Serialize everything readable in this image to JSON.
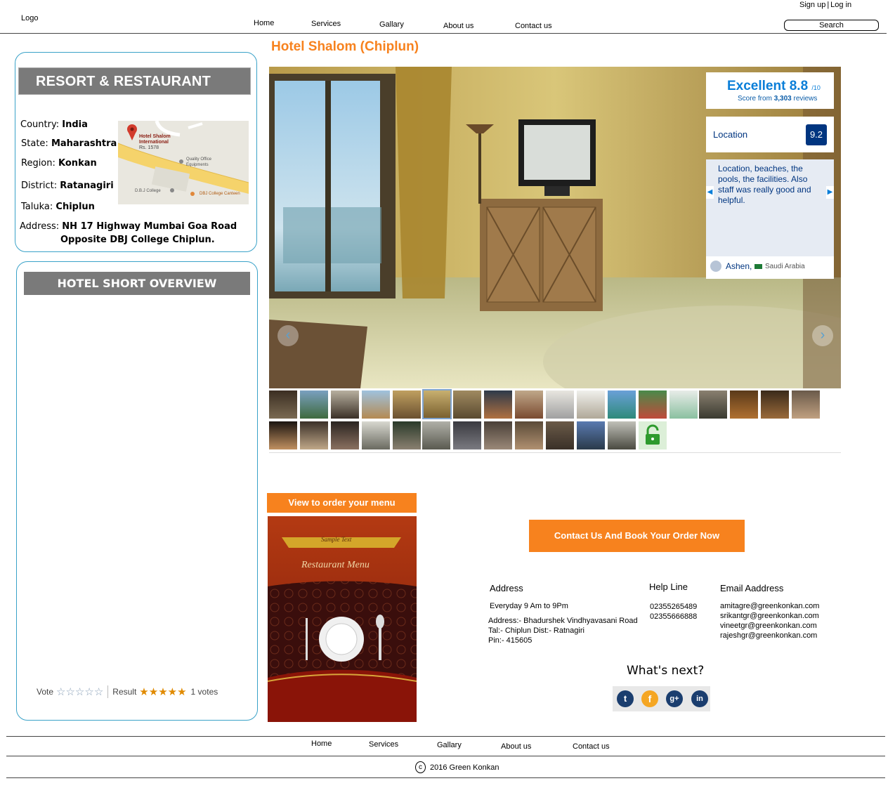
{
  "header": {
    "logo": "Logo",
    "signup": "Sign up",
    "sep": "|",
    "login": "Log in",
    "nav": [
      "Home",
      "Services",
      "Gallary",
      "About us",
      "Contact us"
    ],
    "search": "Search"
  },
  "resort": {
    "title": "RESORT & RESTAURANT",
    "country_label": "Country:",
    "country": "India",
    "state_label": "State:",
    "state": "Maharashtra",
    "region_label": "Region:",
    "region": "Konkan",
    "district_label": "District:",
    "district": "Ratanagiri",
    "taluka_label": "Taluka:",
    "taluka": "Chiplun",
    "address_label": "Address:",
    "address_line1": "NH 17 Highway Mumbai Goa Road",
    "address_line2": "Opposite DBJ College Chiplun."
  },
  "map": {
    "hotel_name_1": "Hotel Shalom",
    "hotel_name_2": "International",
    "hotel_price": "Rs. 1578",
    "quality_1": "Quality Office",
    "quality_2": "Equipments",
    "college": "D.B.J College",
    "canteen": "DBJ College Canteen"
  },
  "overview": {
    "title": "HOTEL SHORT OVERVIEW",
    "vote_label": "Vote",
    "vote_stars": "☆☆☆☆☆",
    "result_label": "Result",
    "result_stars": "★★★★★",
    "votes": "1 votes"
  },
  "hotel": {
    "title": "Hotel Shalom (Chiplun)"
  },
  "review": {
    "rating_label": "Excellent",
    "rating": "8.8",
    "rating_max": "/10",
    "score_from": "Score from",
    "reviews_count": "3,303",
    "reviews_word": "reviews",
    "location_label": "Location",
    "location_score": "9.2",
    "quote": "Location, beaches, the pools, the facilities. Also staff was really good and helpful.",
    "reviewer": "Ashen,",
    "reviewer_country": "Saudi Arabia"
  },
  "menu": {
    "button": "View to order your menu",
    "image_text_top": "Sample Text",
    "image_text_title": "Restaurant Menu"
  },
  "contact": {
    "button": "Contact Us And Book Your Order Now",
    "address_title": "Address",
    "hours": "Everyday 9 Am to 9Pm",
    "address_1": "Address:- Bhadurshek Vindhyavasani Road",
    "address_2": "Tal:- Chiplun Dist:- Ratnagiri",
    "address_3": "Pin:- 415605",
    "helpline_title": "Help Line",
    "phone_1": "02355265489",
    "phone_2": "02355666888",
    "email_title": "Email Aaddress",
    "emails": [
      "amitagre@greenkonkan.com",
      "srikantgr@greenkonkan.com",
      "vineetgr@greenkonkan.com",
      "rajeshgr@greenkonkan.com"
    ],
    "whats_next": "What's next?"
  },
  "social": {
    "icons": [
      "twitter-icon",
      "facebook-icon",
      "google-plus-icon",
      "linkedin-icon"
    ],
    "colors": [
      "#1b3e6f",
      "#f5a623",
      "#1b3e6f",
      "#1b3e6f"
    ]
  },
  "footer": {
    "nav": [
      "Home",
      "Services",
      "Gallary",
      "About us",
      "Contact us"
    ],
    "copyright_symbol": "c",
    "copyright": "2016 Green Konkan"
  },
  "colors": {
    "accent_orange": "#f7821e",
    "panel_border": "#3aa2c8",
    "grey_bar": "#7a7a7a",
    "score_blue": "#0a7ed8",
    "score_dark": "#003580"
  }
}
